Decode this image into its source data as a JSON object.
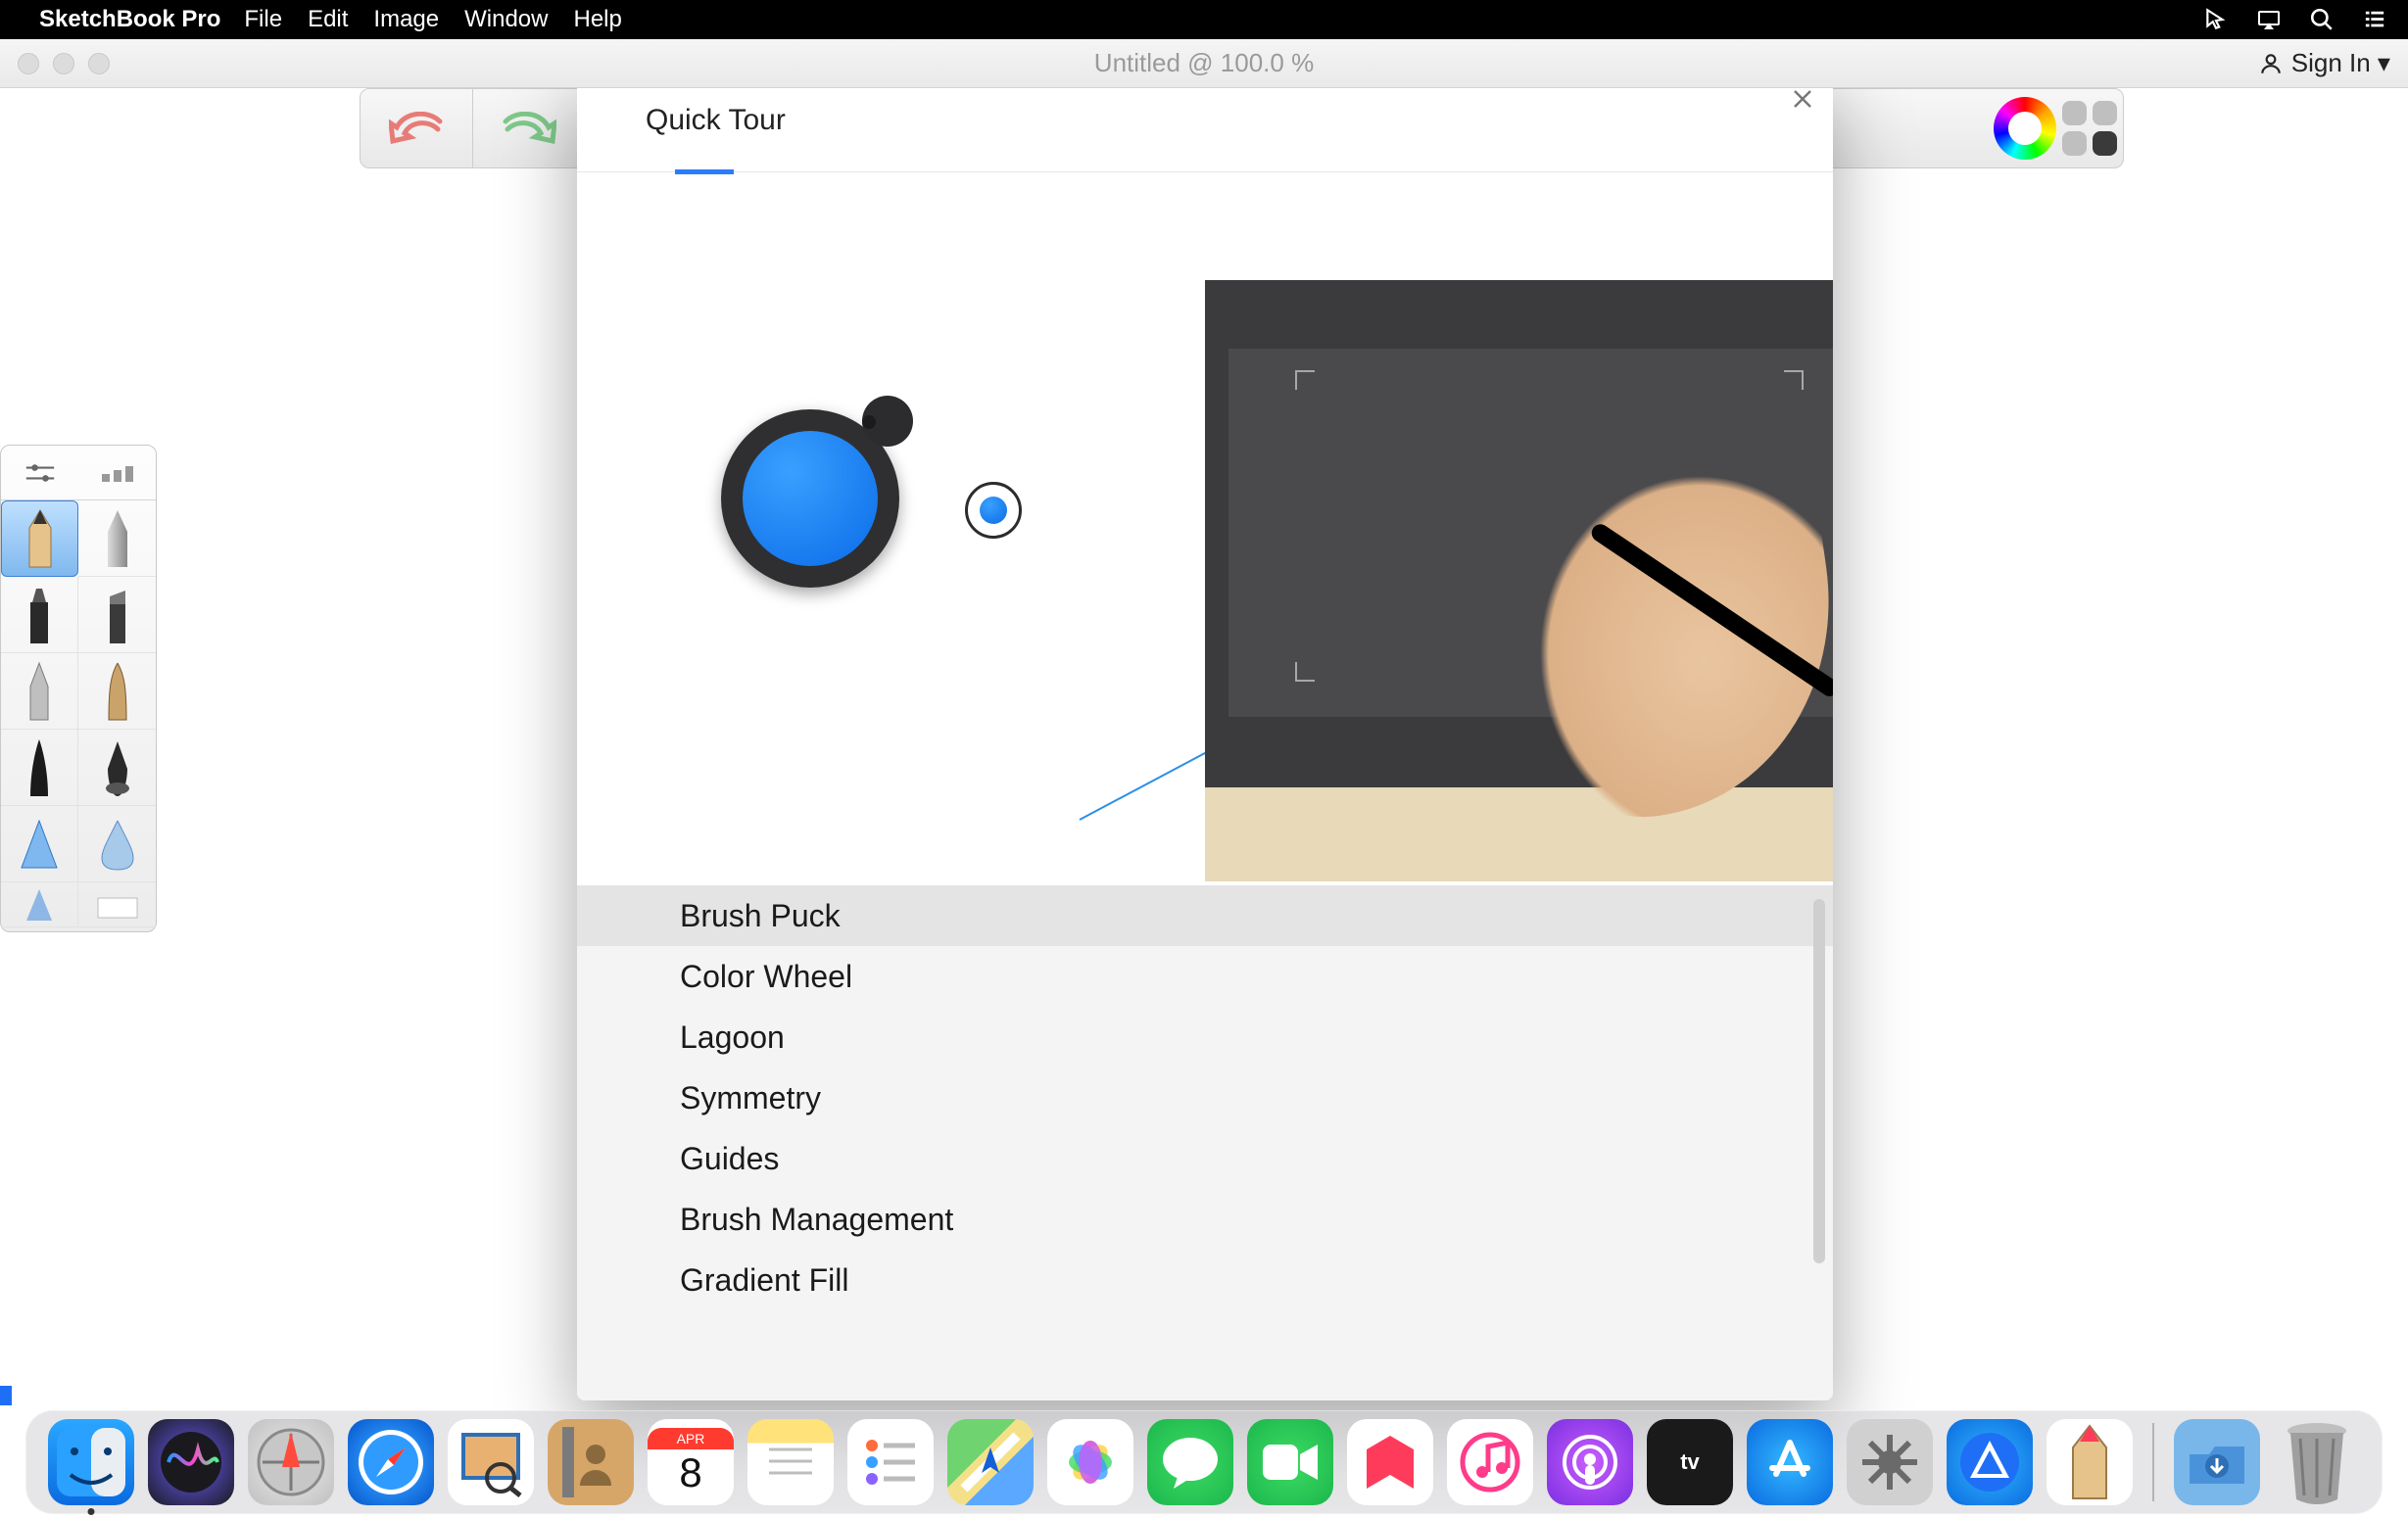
{
  "menubar": {
    "app_name": "SketchBook Pro",
    "items": [
      "File",
      "Edit",
      "Image",
      "Window",
      "Help"
    ]
  },
  "window": {
    "title": "Untitled @ 100.0 %",
    "sign_in": "Sign In ▾"
  },
  "toolbar": {
    "undo": "undo",
    "redo": "redo"
  },
  "brush_palette": {
    "tier1": "sliders",
    "tier2": "presets"
  },
  "quick_tour": {
    "title": "Quick Tour",
    "items": [
      "Brush Puck",
      "Color Wheel",
      "Lagoon",
      "Symmetry",
      "Guides",
      "Brush Management",
      "Gradient Fill"
    ],
    "selected_index": 0
  },
  "dock": {
    "calendar": {
      "month": "APR",
      "day": "8"
    },
    "running": [
      "finder"
    ]
  }
}
